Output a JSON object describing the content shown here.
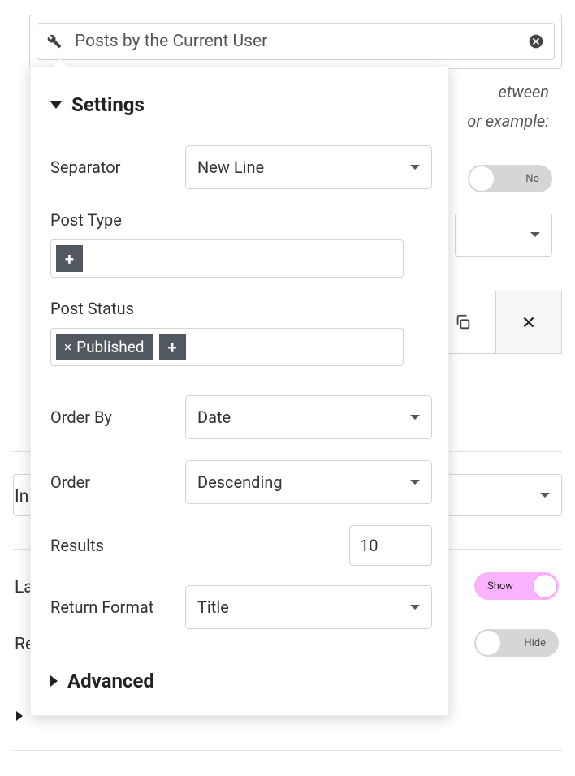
{
  "header": {
    "title": "Posts by the Current User"
  },
  "background": {
    "hint_line1": "etween",
    "hint_line2": "or example:",
    "toggle_no": "No",
    "toggle_show": "Show",
    "toggle_hide": "Hide",
    "label_in": "In",
    "label_la": "La",
    "label_re": "Re"
  },
  "popover": {
    "section_settings": "Settings",
    "section_advanced": "Advanced",
    "labels": {
      "separator": "Separator",
      "post_type": "Post Type",
      "post_status": "Post Status",
      "order_by": "Order By",
      "order": "Order",
      "results": "Results",
      "return_format": "Return Format"
    },
    "values": {
      "separator": "New Line",
      "order_by": "Date",
      "order": "Descending",
      "results": "10",
      "return_format": "Title"
    },
    "post_status_tags": {
      "published": "Published"
    }
  }
}
